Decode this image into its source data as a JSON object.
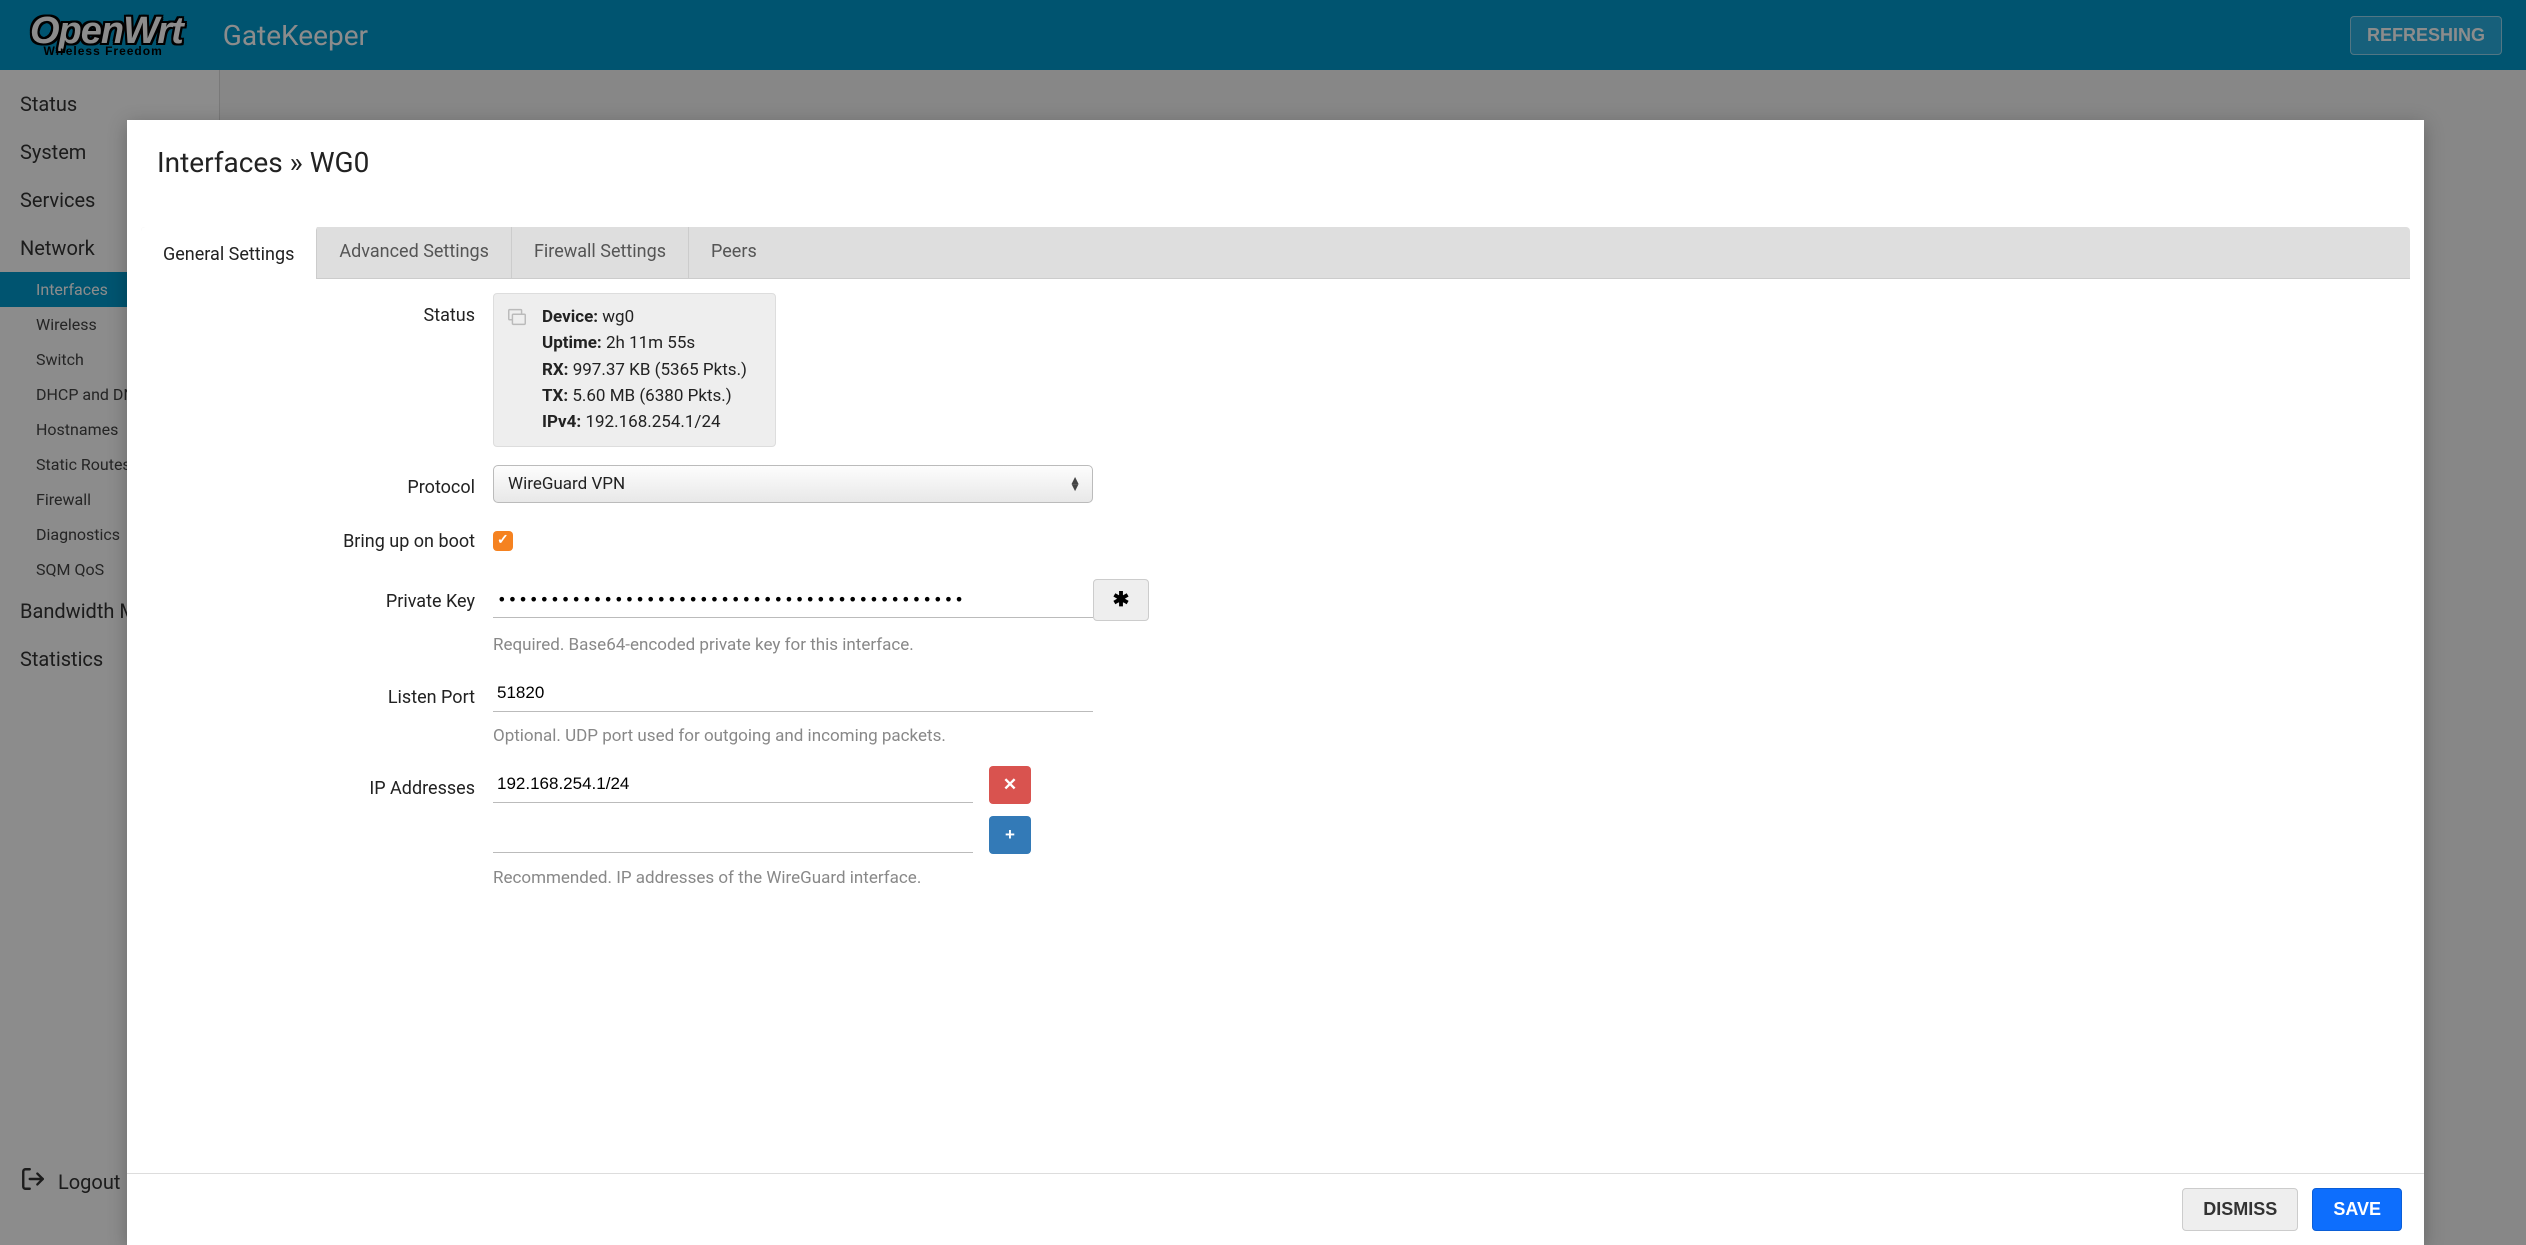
{
  "header": {
    "logo_main": "OpenWrt",
    "logo_sub": "Wireless Freedom",
    "hostname": "GateKeeper",
    "refreshing": "REFRESHING"
  },
  "sidebar": {
    "cats": [
      {
        "label": "Status"
      },
      {
        "label": "System"
      },
      {
        "label": "Services"
      },
      {
        "label": "Network",
        "items": [
          {
            "label": "Interfaces",
            "active": true
          },
          {
            "label": "Wireless"
          },
          {
            "label": "Switch"
          },
          {
            "label": "DHCP and DNS"
          },
          {
            "label": "Hostnames"
          },
          {
            "label": "Static Routes"
          },
          {
            "label": "Firewall"
          },
          {
            "label": "Diagnostics"
          },
          {
            "label": "SQM QoS"
          }
        ]
      },
      {
        "label": "Bandwidth Monitor"
      },
      {
        "label": "Statistics"
      }
    ],
    "logout": "Logout"
  },
  "modal": {
    "title": "Interfaces » WG0",
    "tabs": [
      "General Settings",
      "Advanced Settings",
      "Firewall Settings",
      "Peers"
    ],
    "active_tab": 0,
    "labels": {
      "status": "Status",
      "protocol": "Protocol",
      "bring_up": "Bring up on boot",
      "private_key": "Private Key",
      "listen_port": "Listen Port",
      "ip_addresses": "IP Addresses"
    },
    "status": {
      "device_label": "Device:",
      "device": "wg0",
      "uptime_label": "Uptime:",
      "uptime": "2h 11m 55s",
      "rx_label": "RX:",
      "rx": "997.37 KB (5365 Pkts.)",
      "tx_label": "TX:",
      "tx": "5.60 MB (6380 Pkts.)",
      "ipv4_label": "IPv4:",
      "ipv4": "192.168.254.1/24"
    },
    "protocol": "WireGuard VPN",
    "bring_up": true,
    "private_key": "••••••••••••••••••••••••••••••••••••••••••••",
    "private_key_help": "Required. Base64-encoded private key for this interface.",
    "listen_port": "51820",
    "listen_port_help": "Optional. UDP port used for outgoing and incoming packets.",
    "ip_addresses": [
      "192.168.254.1/24"
    ],
    "ip_help": "Recommended. IP addresses of the WireGuard interface.",
    "footer": {
      "dismiss": "DISMISS",
      "save": "SAVE"
    }
  }
}
